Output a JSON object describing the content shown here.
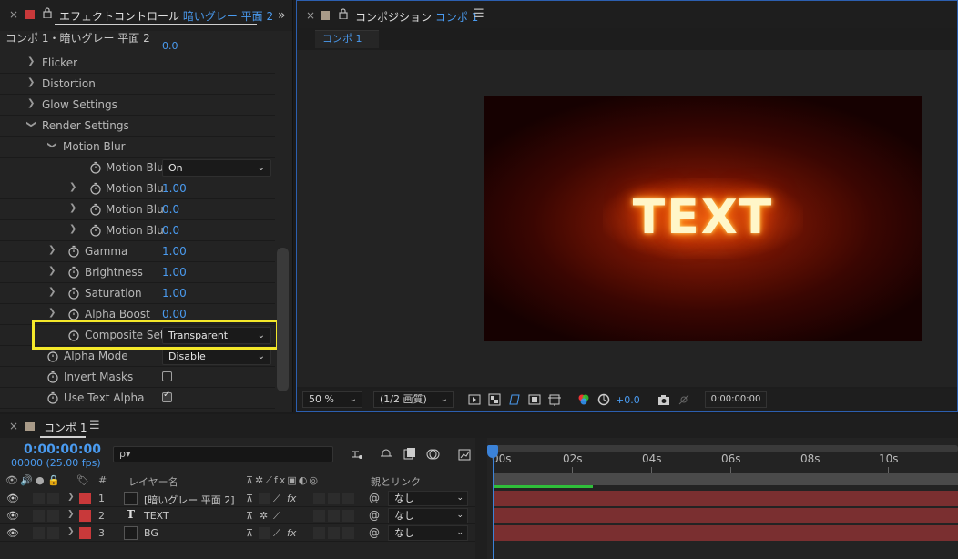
{
  "effect_controls": {
    "close": "×",
    "tab_title_prefix": "エフェクトコントロール",
    "tab_title_layer": "暗いグレー 平面 2",
    "more": "»",
    "subtitle": "コンポ 1・暗いグレー 平面 2",
    "scrolled_value": "0.0",
    "rows": {
      "flicker": "Flicker",
      "distortion": "Distortion",
      "glow_settings": "Glow Settings",
      "render_settings": "Render Settings",
      "motion_blur": "Motion Blur",
      "mb1_label": "Motion Blu",
      "mb1_value": "On",
      "mb2_label": "Motion Blu",
      "mb2_value": "1.00",
      "mb3_label": "Motion Blu",
      "mb3_value": "0.0",
      "mb4_label": "Motion Blu",
      "mb4_value": "0.0",
      "gamma_label": "Gamma",
      "gamma_value": "1.00",
      "brightness_label": "Brightness",
      "brightness_value": "1.00",
      "saturation_label": "Saturation",
      "saturation_value": "1.00",
      "alpha_boost_label": "Alpha Boost",
      "alpha_boost_value": "0.00",
      "composite_label": "Composite Set",
      "composite_value": "Transparent",
      "alpha_mode_label": "Alpha Mode",
      "alpha_mode_value": "Disable",
      "invert_masks_label": "Invert Masks",
      "invert_masks_checked": false,
      "use_text_alpha_label": "Use Text Alpha",
      "use_text_alpha_checked": true
    }
  },
  "composition": {
    "close": "×",
    "tab_title_prefix": "コンポジション",
    "tab_title_comp": "コンポ 1",
    "subtab": "コンポ 1",
    "preview_text": "TEXT",
    "zoom": "50 %",
    "resolution": "(1/2 画質)",
    "exposure": "+0.0",
    "timecode": "0:00:00:00"
  },
  "timeline": {
    "close": "×",
    "tab_title": "コンポ 1",
    "current_time": "0:00:00:00",
    "fps": "00000 (25.00 fps)",
    "search_icon": "ρ▾",
    "header": {
      "index": "#",
      "layer_name": "レイヤー名",
      "parent_link": "親とリンク"
    },
    "ticks": [
      "00s",
      "02s",
      "04s",
      "06s",
      "08s",
      "10s"
    ],
    "layers": [
      {
        "num": "1",
        "name": "[暗いグレー 平面 2]",
        "parent": "なし",
        "type": "solid"
      },
      {
        "num": "2",
        "name": "TEXT",
        "parent": "なし",
        "type": "text"
      },
      {
        "num": "3",
        "name": "BG",
        "parent": "なし",
        "type": "solid"
      }
    ]
  },
  "colors": {
    "accent_blue": "#4a9bf0",
    "highlight_yellow": "#f4e82a",
    "label_red": "#c8393a",
    "track_red": "#7a2f30"
  }
}
